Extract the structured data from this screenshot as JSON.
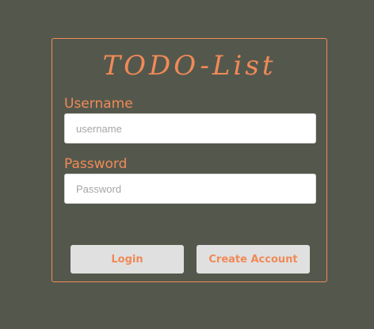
{
  "colors": {
    "background": "#54584c",
    "accent": "#f08a57",
    "field_bg": "#ffffff",
    "button_bg": "#e0e0e0"
  },
  "login_form": {
    "title": "TODO-List",
    "username": {
      "label": "Username",
      "placeholder": "username",
      "value": ""
    },
    "password": {
      "label": "Password",
      "placeholder": "Password",
      "value": ""
    },
    "login_button": "Login",
    "create_account_button": "Create Account"
  }
}
